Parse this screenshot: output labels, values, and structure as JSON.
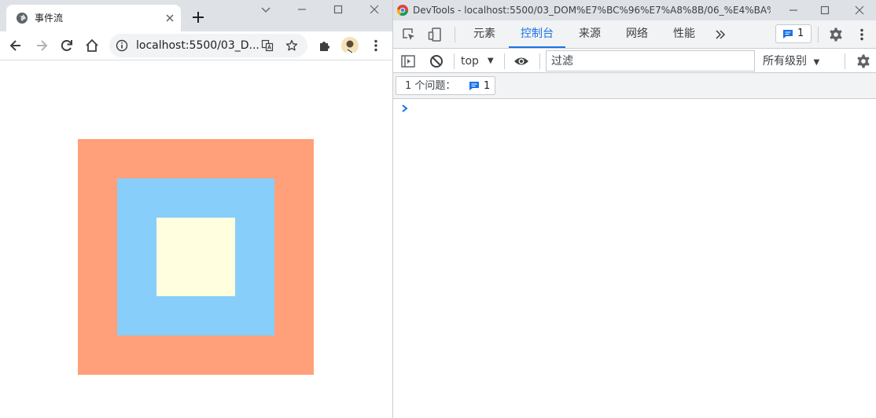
{
  "browser": {
    "tab_title": "事件流",
    "url": "localhost:5500/03_D...",
    "colors": {
      "outer_box": "#ffa07a",
      "middle_box": "#87cefa",
      "inner_box": "#ffffe0"
    }
  },
  "devtools": {
    "window_title": "DevTools - localhost:5500/03_DOM%E7%BC%96%E7%A8%8B/06_%E4%BA%8B...",
    "tabs": [
      "元素",
      "控制台",
      "来源",
      "网络",
      "性能"
    ],
    "active_tab": "控制台",
    "issues_count": "1",
    "context": "top",
    "filter_placeholder": "过滤",
    "levels_label": "所有级别",
    "issues_label": "1 个问题：",
    "issues_chip_count": "1",
    "accent_color": "#1a73e8"
  }
}
